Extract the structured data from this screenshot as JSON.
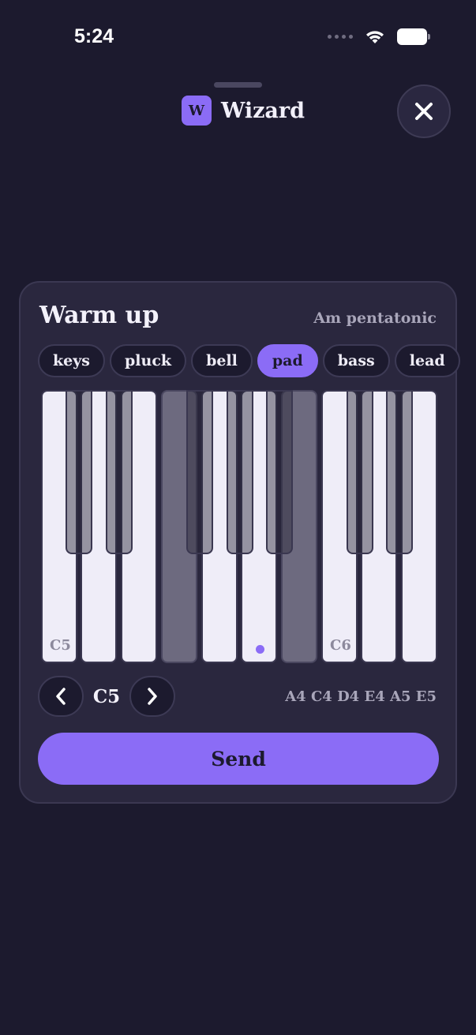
{
  "status_bar": {
    "time": "5:24"
  },
  "header": {
    "logo_letter": "W",
    "app_name": "Wizard"
  },
  "card": {
    "title": "Warm up",
    "scale": "Am pentatonic",
    "instruments": [
      "keys",
      "pluck",
      "bell",
      "pad",
      "bass",
      "lead"
    ],
    "selected_instrument": "pad",
    "keyboard": {
      "white_keys": [
        {
          "label": "C5",
          "state": "normal"
        },
        {
          "label": "",
          "state": "normal"
        },
        {
          "label": "",
          "state": "normal"
        },
        {
          "label": "",
          "state": "shaded"
        },
        {
          "label": "",
          "state": "normal"
        },
        {
          "label": "",
          "state": "active"
        },
        {
          "label": "",
          "state": "shaded"
        },
        {
          "label": "C6",
          "state": "normal"
        },
        {
          "label": "",
          "state": "normal"
        },
        {
          "label": "",
          "state": "normal"
        }
      ]
    },
    "octave": "C5",
    "notes": "A4 C4 D4 E4 A5 E5",
    "send_label": "Send"
  },
  "colors": {
    "accent": "#8b6cf6",
    "background": "#1c1a2e",
    "card": "#2a273e"
  },
  "icons": [
    "signal-icon",
    "wifi-icon",
    "battery-icon",
    "close-icon",
    "chevron-left-icon",
    "chevron-right-icon"
  ]
}
